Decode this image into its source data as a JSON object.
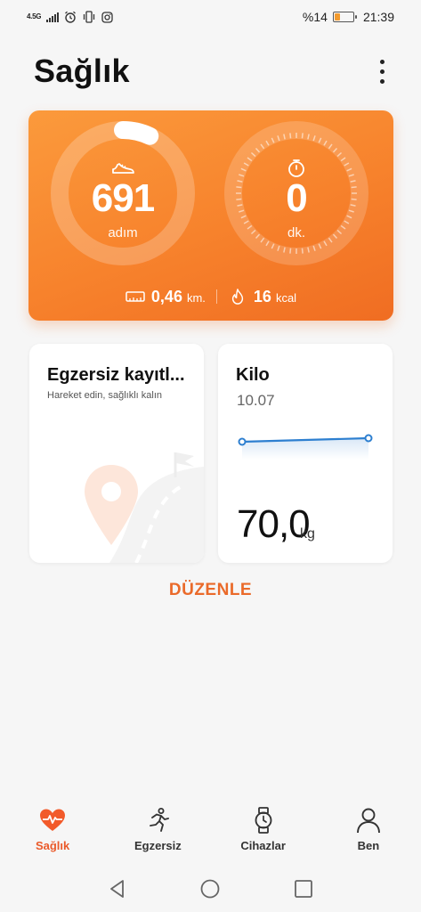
{
  "status_bar": {
    "network": "4.5G",
    "battery_text": "%14",
    "battery_level": 0.14,
    "time": "21:39",
    "icons": [
      "signal-icon",
      "alarm-icon",
      "vibrate-icon",
      "instagram-icon",
      "battery-icon"
    ]
  },
  "header": {
    "title": "Sağlık",
    "menu_icon": "more-vertical-icon"
  },
  "activity": {
    "steps_value": "691",
    "steps_unit": "adım",
    "steps_progress": 0.07,
    "minutes_value": "0",
    "minutes_unit": "dk.",
    "minutes_progress": 0,
    "distance_value": "0,46",
    "distance_unit": "km.",
    "calories_value": "16",
    "calories_unit": "kcal",
    "colors": {
      "card_start": "#fb9a3c",
      "card_end": "#f06d22"
    }
  },
  "exercise_card": {
    "title": "Egzersiz kayıtl...",
    "subtitle": "Hareket edin, sağlıklı kalın"
  },
  "weight_card": {
    "title": "Kilo",
    "date": "10.07",
    "value": "70,0",
    "unit": "kg",
    "line_color": "#2d7fd0"
  },
  "edit_label": "DÜZENLE",
  "bottom_nav": {
    "items": [
      {
        "label": "Sağlık",
        "icon": "heart-pulse-icon",
        "active": true
      },
      {
        "label": "Egzersiz",
        "icon": "runner-icon",
        "active": false
      },
      {
        "label": "Cihazlar",
        "icon": "watch-icon",
        "active": false
      },
      {
        "label": "Ben",
        "icon": "person-icon",
        "active": false
      }
    ]
  },
  "accent_color": "#ea6a2a"
}
